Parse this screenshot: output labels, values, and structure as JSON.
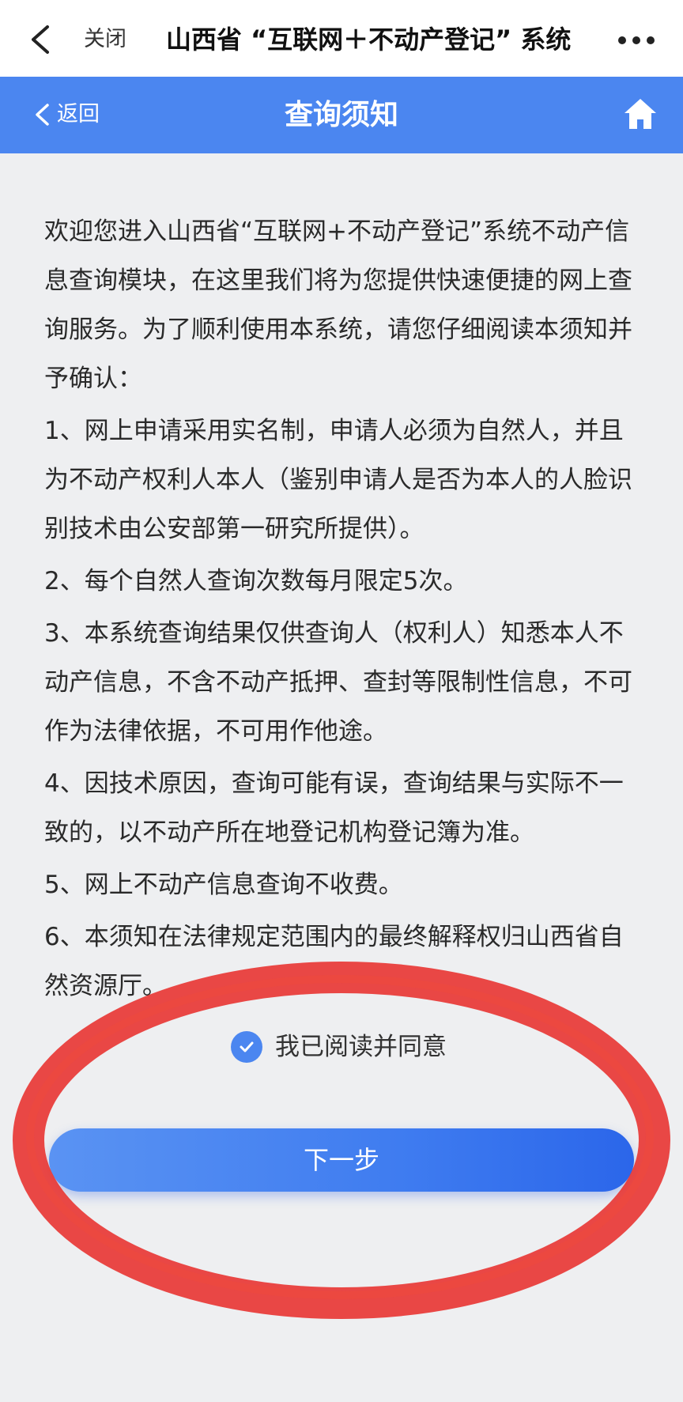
{
  "topbar": {
    "close_label": "关闭",
    "app_title": "山西省 “互联网＋不动产登记” 系统"
  },
  "header": {
    "back_label": "返回",
    "title": "查询须知"
  },
  "notice": {
    "intro": "欢迎您进入山西省“互联网+不动产登记”系统不动产信息查询模块，在这里我们将为您提供快速便捷的网上查询服务。为了顺利使用本系统，请您仔细阅读本须知并予确认：",
    "items": [
      "1、网上申请采用实名制，申请人必须为自然人，并且为不动产权利人本人（鉴别申请人是否为本人的人脸识别技术由公安部第一研究所提供）。",
      "2、每个自然人查询次数每月限定5次。",
      "3、本系统查询结果仅供查询人（权利人）知悉本人不动产信息，不含不动产抵押、查封等限制性信息，不可作为法律依据，不可用作他途。",
      "4、因技术原因，查询可能有误，查询结果与实际不一致的，以不动产所在地登记机构登记簿为准。",
      "5、网上不动产信息查询不收费。",
      "6、本须知在法律规定范围内的最终解释权归山西省自然资源厅。"
    ]
  },
  "agreement": {
    "label": "我已阅读并同意",
    "checked": true
  },
  "next_button": {
    "label": "下一步"
  },
  "colors": {
    "header_blue": "#4b86f0",
    "button_blue": "#3f7cf0",
    "annotation_red": "#e8302c",
    "background": "#eeeff1"
  },
  "icons": {
    "topbar_back": "chevron-left-icon",
    "topbar_more": "more-dots-icon",
    "header_back": "chevron-left-icon",
    "header_home": "home-icon",
    "agree_check": "check-circle-icon"
  }
}
